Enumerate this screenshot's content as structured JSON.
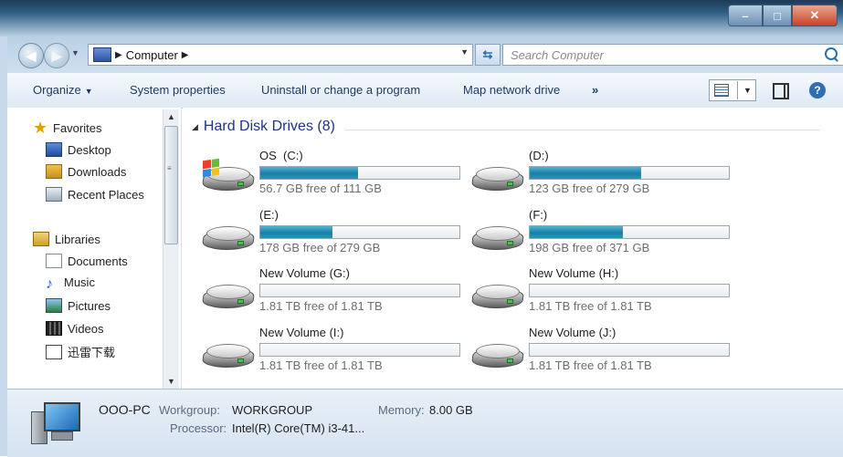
{
  "window": {
    "minimize_label": "–",
    "maximize_label": "□",
    "close_label": "✕"
  },
  "address": {
    "path": [
      "Computer"
    ],
    "search_placeholder": "Search Computer"
  },
  "toolbar": {
    "organize_label": "Organize",
    "system_properties_label": "System properties",
    "uninstall_label": "Uninstall or change a program",
    "map_drive_label": "Map network drive",
    "more_label": "»"
  },
  "sidebar": {
    "favorites": {
      "label": "Favorites",
      "items": [
        {
          "label": "Desktop",
          "icon": "desktop-icon"
        },
        {
          "label": "Downloads",
          "icon": "downloads-icon"
        },
        {
          "label": "Recent Places",
          "icon": "recent-places-icon"
        }
      ]
    },
    "libraries": {
      "label": "Libraries",
      "items": [
        {
          "label": "Documents",
          "icon": "documents-icon"
        },
        {
          "label": "Music",
          "icon": "music-icon"
        },
        {
          "label": "Pictures",
          "icon": "pictures-icon"
        },
        {
          "label": "Videos",
          "icon": "videos-icon"
        },
        {
          "label": "迅雷下载",
          "icon": "xunlei-download-icon"
        }
      ]
    }
  },
  "content": {
    "group_title": "Hard Disk Drives (8)",
    "drives": [
      {
        "label": "OS  (C:)",
        "free_text": "56.7 GB free of 111 GB",
        "used_fraction": 0.489,
        "system": true
      },
      {
        "label": "(D:)",
        "free_text": "123 GB free of 279 GB",
        "used_fraction": 0.559,
        "system": false
      },
      {
        "label": "(E:)",
        "free_text": "178 GB free of 279 GB",
        "used_fraction": 0.362,
        "system": false
      },
      {
        "label": "(F:)",
        "free_text": "198 GB free of 371 GB",
        "used_fraction": 0.466,
        "system": false
      },
      {
        "label": "New Volume (G:)",
        "free_text": "1.81 TB free of 1.81 TB",
        "used_fraction": 0.0,
        "system": false
      },
      {
        "label": "New Volume (H:)",
        "free_text": "1.81 TB free of 1.81 TB",
        "used_fraction": 0.0,
        "system": false
      },
      {
        "label": "New Volume (I:)",
        "free_text": "1.81 TB free of 1.81 TB",
        "used_fraction": 0.0,
        "system": false
      },
      {
        "label": "New Volume (J:)",
        "free_text": "1.81 TB free of 1.81 TB",
        "used_fraction": 0.0,
        "system": false
      }
    ]
  },
  "details": {
    "pc_name": "OOO-PC",
    "workgroup_label": "Workgroup:",
    "workgroup_value": "WORKGROUP",
    "memory_label": "Memory:",
    "memory_value": "8.00 GB",
    "processor_label": "Processor:",
    "processor_value": "Intel(R) Core(TM) i3-41..."
  },
  "colors": {
    "bar_fill": "#1a7fa6",
    "group_title": "#1e3287"
  }
}
